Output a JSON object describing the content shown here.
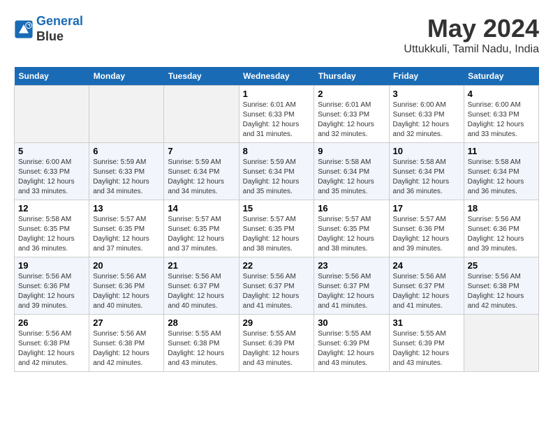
{
  "header": {
    "logo_line1": "General",
    "logo_line2": "Blue",
    "title": "May 2024",
    "location": "Uttukkuli, Tamil Nadu, India"
  },
  "calendar": {
    "days_of_week": [
      "Sunday",
      "Monday",
      "Tuesday",
      "Wednesday",
      "Thursday",
      "Friday",
      "Saturday"
    ],
    "weeks": [
      [
        {
          "day": "",
          "info": ""
        },
        {
          "day": "",
          "info": ""
        },
        {
          "day": "",
          "info": ""
        },
        {
          "day": "1",
          "info": "Sunrise: 6:01 AM\nSunset: 6:33 PM\nDaylight: 12 hours\nand 31 minutes."
        },
        {
          "day": "2",
          "info": "Sunrise: 6:01 AM\nSunset: 6:33 PM\nDaylight: 12 hours\nand 32 minutes."
        },
        {
          "day": "3",
          "info": "Sunrise: 6:00 AM\nSunset: 6:33 PM\nDaylight: 12 hours\nand 32 minutes."
        },
        {
          "day": "4",
          "info": "Sunrise: 6:00 AM\nSunset: 6:33 PM\nDaylight: 12 hours\nand 33 minutes."
        }
      ],
      [
        {
          "day": "5",
          "info": "Sunrise: 6:00 AM\nSunset: 6:33 PM\nDaylight: 12 hours\nand 33 minutes."
        },
        {
          "day": "6",
          "info": "Sunrise: 5:59 AM\nSunset: 6:33 PM\nDaylight: 12 hours\nand 34 minutes."
        },
        {
          "day": "7",
          "info": "Sunrise: 5:59 AM\nSunset: 6:34 PM\nDaylight: 12 hours\nand 34 minutes."
        },
        {
          "day": "8",
          "info": "Sunrise: 5:59 AM\nSunset: 6:34 PM\nDaylight: 12 hours\nand 35 minutes."
        },
        {
          "day": "9",
          "info": "Sunrise: 5:58 AM\nSunset: 6:34 PM\nDaylight: 12 hours\nand 35 minutes."
        },
        {
          "day": "10",
          "info": "Sunrise: 5:58 AM\nSunset: 6:34 PM\nDaylight: 12 hours\nand 36 minutes."
        },
        {
          "day": "11",
          "info": "Sunrise: 5:58 AM\nSunset: 6:34 PM\nDaylight: 12 hours\nand 36 minutes."
        }
      ],
      [
        {
          "day": "12",
          "info": "Sunrise: 5:58 AM\nSunset: 6:35 PM\nDaylight: 12 hours\nand 36 minutes."
        },
        {
          "day": "13",
          "info": "Sunrise: 5:57 AM\nSunset: 6:35 PM\nDaylight: 12 hours\nand 37 minutes."
        },
        {
          "day": "14",
          "info": "Sunrise: 5:57 AM\nSunset: 6:35 PM\nDaylight: 12 hours\nand 37 minutes."
        },
        {
          "day": "15",
          "info": "Sunrise: 5:57 AM\nSunset: 6:35 PM\nDaylight: 12 hours\nand 38 minutes."
        },
        {
          "day": "16",
          "info": "Sunrise: 5:57 AM\nSunset: 6:35 PM\nDaylight: 12 hours\nand 38 minutes."
        },
        {
          "day": "17",
          "info": "Sunrise: 5:57 AM\nSunset: 6:36 PM\nDaylight: 12 hours\nand 39 minutes."
        },
        {
          "day": "18",
          "info": "Sunrise: 5:56 AM\nSunset: 6:36 PM\nDaylight: 12 hours\nand 39 minutes."
        }
      ],
      [
        {
          "day": "19",
          "info": "Sunrise: 5:56 AM\nSunset: 6:36 PM\nDaylight: 12 hours\nand 39 minutes."
        },
        {
          "day": "20",
          "info": "Sunrise: 5:56 AM\nSunset: 6:36 PM\nDaylight: 12 hours\nand 40 minutes."
        },
        {
          "day": "21",
          "info": "Sunrise: 5:56 AM\nSunset: 6:37 PM\nDaylight: 12 hours\nand 40 minutes."
        },
        {
          "day": "22",
          "info": "Sunrise: 5:56 AM\nSunset: 6:37 PM\nDaylight: 12 hours\nand 41 minutes."
        },
        {
          "day": "23",
          "info": "Sunrise: 5:56 AM\nSunset: 6:37 PM\nDaylight: 12 hours\nand 41 minutes."
        },
        {
          "day": "24",
          "info": "Sunrise: 5:56 AM\nSunset: 6:37 PM\nDaylight: 12 hours\nand 41 minutes."
        },
        {
          "day": "25",
          "info": "Sunrise: 5:56 AM\nSunset: 6:38 PM\nDaylight: 12 hours\nand 42 minutes."
        }
      ],
      [
        {
          "day": "26",
          "info": "Sunrise: 5:56 AM\nSunset: 6:38 PM\nDaylight: 12 hours\nand 42 minutes."
        },
        {
          "day": "27",
          "info": "Sunrise: 5:56 AM\nSunset: 6:38 PM\nDaylight: 12 hours\nand 42 minutes."
        },
        {
          "day": "28",
          "info": "Sunrise: 5:55 AM\nSunset: 6:38 PM\nDaylight: 12 hours\nand 43 minutes."
        },
        {
          "day": "29",
          "info": "Sunrise: 5:55 AM\nSunset: 6:39 PM\nDaylight: 12 hours\nand 43 minutes."
        },
        {
          "day": "30",
          "info": "Sunrise: 5:55 AM\nSunset: 6:39 PM\nDaylight: 12 hours\nand 43 minutes."
        },
        {
          "day": "31",
          "info": "Sunrise: 5:55 AM\nSunset: 6:39 PM\nDaylight: 12 hours\nand 43 minutes."
        },
        {
          "day": "",
          "info": ""
        }
      ]
    ]
  }
}
